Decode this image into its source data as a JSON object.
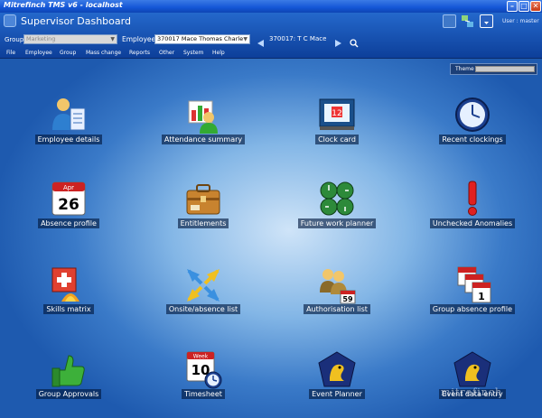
{
  "window": {
    "title": "Mitrefinch TMS v6 - localhost"
  },
  "header": {
    "app_title": "Supervisor Dashboard",
    "user_label": "User : master"
  },
  "toolbar": {
    "group_label": "Group",
    "group_value": "Marketing",
    "employee_label": "Employee",
    "employee_value": "370017  Mace  Thomas Charles",
    "employee_display": "370017: T C Mace"
  },
  "menu": [
    "File",
    "Employee",
    "Group",
    "Mass change",
    "Reports",
    "Other",
    "System",
    "Help"
  ],
  "theme": {
    "label": "Theme",
    "value": ""
  },
  "tiles": [
    {
      "label": "Employee details",
      "icon": "employee-details-icon"
    },
    {
      "label": "Attendance summary",
      "icon": "attendance-summary-icon"
    },
    {
      "label": "Clock card",
      "icon": "clock-card-icon"
    },
    {
      "label": "Recent clockings",
      "icon": "recent-clockings-icon"
    },
    {
      "label": "Absence profile",
      "icon": "absence-profile-icon"
    },
    {
      "label": "Entitlements",
      "icon": "entitlements-icon"
    },
    {
      "label": "Future work planner",
      "icon": "future-work-planner-icon"
    },
    {
      "label": "Unchecked Anomalies",
      "icon": "unchecked-anomalies-icon"
    },
    {
      "label": "Skills matrix",
      "icon": "skills-matrix-icon"
    },
    {
      "label": "Onsite/absence list",
      "icon": "onsite-absence-list-icon"
    },
    {
      "label": "Authorisation list",
      "icon": "authorisation-list-icon"
    },
    {
      "label": "Group absence profile",
      "icon": "group-absence-profile-icon"
    },
    {
      "label": "Group Approvals",
      "icon": "group-approvals-icon"
    },
    {
      "label": "Timesheet",
      "icon": "timesheet-icon"
    },
    {
      "label": "Event Planner",
      "icon": "event-planner-icon"
    },
    {
      "label": "Event data entry",
      "icon": "event-data-entry-icon"
    }
  ],
  "icon_text": {
    "clock_card": "12",
    "absence_month": "Apr",
    "absence_day": "26",
    "auth_count": "59",
    "timesheet_month": "Week",
    "timesheet_day": "10"
  },
  "watermark": "mitrefinch",
  "colors": {
    "accent": "#1456d6",
    "panel_light": "#cfe4f8",
    "panel_dark": "#1e5aaf",
    "close": "#c83a16"
  }
}
